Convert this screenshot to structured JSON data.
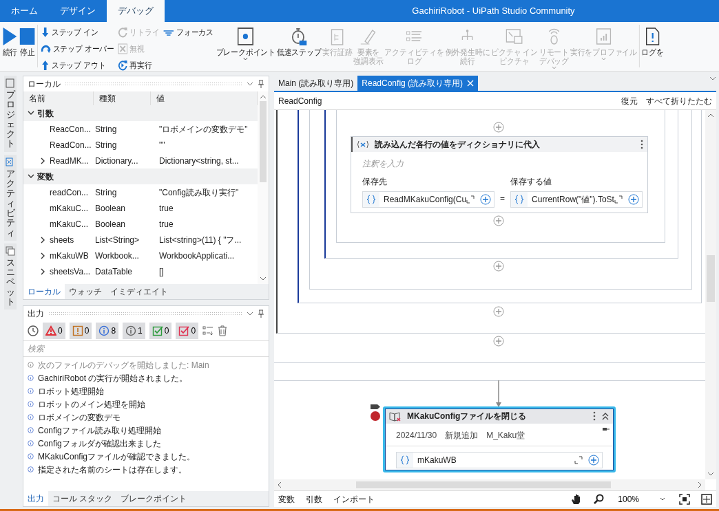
{
  "title_bar": {
    "tabs": [
      {
        "label": "ホーム",
        "selected": false
      },
      {
        "label": "デザイン",
        "selected": false
      },
      {
        "label": "デバッグ",
        "selected": true
      }
    ],
    "title": "GachiriRobot - UiPath Studio Community"
  },
  "ribbon": {
    "groups": [
      {
        "items": [
          {
            "kind": "large",
            "label": "続行",
            "disabled": false,
            "dropdown": false
          },
          {
            "kind": "large",
            "label": "停止",
            "disabled": false,
            "dropdown": false
          }
        ]
      },
      {
        "items": [
          {
            "kind": "stack",
            "items": [
              {
                "label": "ステップ イン",
                "disabled": false
              },
              {
                "label": "ステップ オーバー",
                "disabled": false
              },
              {
                "label": "ステップ アウト",
                "disabled": false
              }
            ]
          },
          {
            "kind": "stack",
            "items": [
              {
                "label": "リトライ",
                "disabled": true
              },
              {
                "label": "無視",
                "disabled": true
              },
              {
                "label": "再実行",
                "disabled": false
              }
            ]
          },
          {
            "kind": "stack",
            "items": [
              {
                "label": "フォーカス",
                "disabled": false
              }
            ]
          },
          {
            "kind": "large",
            "label": "ブレークポイント",
            "disabled": false,
            "dropdown": true
          },
          {
            "kind": "large",
            "label": "低速ステップ",
            "disabled": false,
            "dropdown": false
          },
          {
            "kind": "large",
            "label": "実行証跡",
            "disabled": true,
            "dropdown": false
          },
          {
            "kind": "large",
            "lines": [
              "要素を",
              "強調表示"
            ],
            "disabled": true,
            "dropdown": false
          },
          {
            "kind": "large",
            "lines": [
              "アクティビティを",
              "ログ"
            ],
            "disabled": true,
            "dropdown": false
          },
          {
            "kind": "large",
            "lines": [
              "例外発生時に",
              "続行"
            ],
            "disabled": true,
            "dropdown": false
          },
          {
            "kind": "large",
            "lines": [
              "ピクチャ イン",
              "ピクチャ"
            ],
            "disabled": true,
            "dropdown": false
          },
          {
            "kind": "large",
            "lines": [
              "リモート",
              "デバッグ"
            ],
            "disabled": true,
            "dropdown": true
          },
          {
            "kind": "large",
            "label": "実行をプロファイル",
            "disabled": true,
            "dropdown": true
          }
        ]
      },
      {
        "items": [
          {
            "kind": "large",
            "label": "ログを",
            "disabled": false,
            "dropdown": false
          }
        ]
      }
    ]
  },
  "side_tabs": [
    {
      "label": "プロジェクト"
    },
    {
      "label": "アクティビティ"
    },
    {
      "label": "スニペット"
    }
  ],
  "locals_panel": {
    "title": "ローカル",
    "columns": [
      "名前",
      "種類",
      "値"
    ],
    "groups": [
      {
        "name": "引数",
        "expanded": true,
        "rows": [
          {
            "name": "ReacCon...",
            "type": "String",
            "value": "\"ロボメインの変数デモ\"",
            "expandable": false
          },
          {
            "name": "ReadCon...",
            "type": "String",
            "value": "\"\"",
            "expandable": false
          },
          {
            "name": "ReadMK...",
            "type": "Dictionary...",
            "value": "Dictionary<string, st...",
            "expandable": true
          }
        ]
      },
      {
        "name": "変数",
        "expanded": true,
        "rows": [
          {
            "name": "readCon...",
            "type": "String",
            "value": "\"Config読み取り実行\"",
            "expandable": false
          },
          {
            "name": "mKakuC...",
            "type": "Boolean",
            "value": "true",
            "expandable": false
          },
          {
            "name": "mKakuC...",
            "type": "Boolean",
            "value": "true",
            "expandable": false
          },
          {
            "name": "sheets",
            "type": "List<String>",
            "value": "List<string>(11) { \"フ...",
            "expandable": true
          },
          {
            "name": "mKakuWB",
            "type": "Workbook...",
            "value": "WorkbookApplicati...",
            "expandable": true
          },
          {
            "name": "sheetsVa...",
            "type": "DataTable",
            "value": "[]",
            "expandable": true
          }
        ]
      }
    ],
    "tabs": [
      {
        "label": "ローカル",
        "selected": true
      },
      {
        "label": "ウォッチ",
        "selected": false
      },
      {
        "label": "イミディエイト",
        "selected": false
      }
    ]
  },
  "output_panel": {
    "title": "出力",
    "filters": [
      {
        "kind": "triangle",
        "color": "#e0303a",
        "count": "0"
      },
      {
        "kind": "bang",
        "color": "#c07020",
        "count": "0"
      },
      {
        "kind": "info",
        "color": "#3a70d8",
        "count": "8"
      },
      {
        "kind": "info",
        "color": "#666666",
        "count": "1"
      },
      {
        "kind": "check",
        "color": "#2a9a3a",
        "count": "0"
      },
      {
        "kind": "check",
        "color": "#e03050",
        "count": "0"
      }
    ],
    "search": {
      "placeholder": "検索"
    },
    "messages": [
      {
        "text": "次のファイルのデバッグを開始しました: Main",
        "muted": true
      },
      {
        "text": "GachiriRobot の実行が開始されました。",
        "muted": false
      },
      {
        "text": "ロボット処理開始",
        "muted": false
      },
      {
        "text": "ロボットのメイン処理を開始",
        "muted": false
      },
      {
        "text": "ロボメインの変数デモ",
        "muted": false
      },
      {
        "text": "Configファイル読み取り処理開始",
        "muted": false
      },
      {
        "text": "Configフォルダが確認出来ました",
        "muted": false
      },
      {
        "text": "MKakuConfigファイルが確認できました。",
        "muted": false
      },
      {
        "text": "指定された名前のシートは存在します。",
        "muted": false
      }
    ],
    "tabs": [
      {
        "label": "出力",
        "selected": true
      },
      {
        "label": "コール スタック",
        "selected": false
      },
      {
        "label": "ブレークポイント",
        "selected": false
      }
    ]
  },
  "document": {
    "tabs": [
      {
        "label": "Main (読み取り専用)",
        "selected": false
      },
      {
        "label": "ReadConfig (読み取り専用)",
        "selected": true
      }
    ],
    "breadcrumb": "ReadConfig",
    "actions": [
      "復元",
      "すべて折りたたむ"
    ],
    "activities": [
      {
        "title": "読み込んだ各行の値をディクショナリに代入",
        "annotation": "注釈を入力",
        "annotation_is_placeholder": true,
        "selected": false,
        "breakpoint": false,
        "fields": [
          {
            "label": "保存先",
            "value": "ReadMKakuConfig(Cu"
          },
          {
            "label": "保存する値",
            "value": "CurrentRow(\"値\").ToSt"
          }
        ],
        "operator": "="
      },
      {
        "title": "MKakuConfigファイルを閉じる",
        "annotation": "2024/11/30　新規追加　M_Kaku堂",
        "annotation_is_placeholder": false,
        "selected": true,
        "breakpoint": true,
        "fields": [
          {
            "value": "mKakuWB"
          }
        ]
      }
    ],
    "bottom_tabs": [
      "変数",
      "引数",
      "インポート"
    ],
    "zoom": "100%"
  }
}
